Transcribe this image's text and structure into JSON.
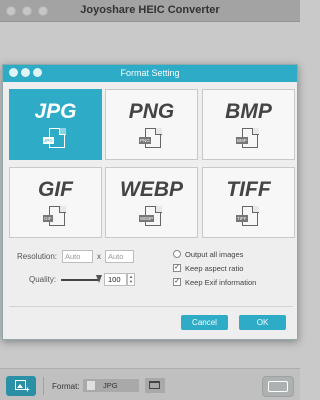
{
  "window": {
    "title": "Joyoshare HEIC Converter"
  },
  "dialog": {
    "title": "Format Setting",
    "formats": [
      {
        "name": "JPG",
        "file_label": "JPG",
        "selected": true
      },
      {
        "name": "PNG",
        "file_label": "PNG",
        "selected": false
      },
      {
        "name": "BMP",
        "file_label": "BMP",
        "selected": false
      },
      {
        "name": "GIF",
        "file_label": "GIF",
        "selected": false
      },
      {
        "name": "WEBP",
        "file_label": "WEBP",
        "selected": false
      },
      {
        "name": "TIFF",
        "file_label": "TIFF",
        "selected": false
      }
    ],
    "resolution": {
      "label": "Resolution:",
      "width_placeholder": "Auto",
      "height_placeholder": "Auto",
      "separator": "x"
    },
    "quality": {
      "label": "Quality:",
      "value": "100",
      "slider_fraction": 1.0
    },
    "options": [
      {
        "label": "Output all images",
        "checked": false
      },
      {
        "label": "Keep aspect ratio",
        "checked": true
      },
      {
        "label": "Keep Exif information",
        "checked": true
      }
    ],
    "cancel_label": "Cancel",
    "ok_label": "OK"
  },
  "bottom": {
    "format_label": "Format:",
    "format_value": "JPG"
  },
  "colors": {
    "accent": "#2eabc6"
  }
}
